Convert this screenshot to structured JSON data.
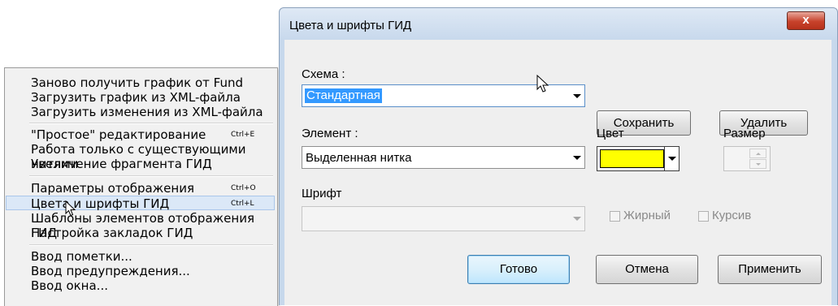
{
  "menu": {
    "items": [
      {
        "label": "Заново получить график от Fund",
        "shortcut": ""
      },
      {
        "label": "Загрузить график из XML-файла",
        "shortcut": ""
      },
      {
        "label": "Загрузить изменения из XML-файла",
        "shortcut": ""
      },
      {
        "label": "\"Простое\" редактирование",
        "shortcut": "Ctrl+E"
      },
      {
        "label": "Работа только с существующими нитями",
        "shortcut": ""
      },
      {
        "label": "Увеличение фрагмента ГИД",
        "shortcut": ""
      },
      {
        "label": "Параметры отображения",
        "shortcut": "Ctrl+O"
      },
      {
        "label": "Цвета и шрифты ГИД",
        "shortcut": "Ctrl+L"
      },
      {
        "label": "Шаблоны элементов отображения ГИД",
        "shortcut": ""
      },
      {
        "label": "Настройка закладок ГИД",
        "shortcut": ""
      },
      {
        "label": "Ввод пометки...",
        "shortcut": ""
      },
      {
        "label": "Ввод предупреждения...",
        "shortcut": ""
      },
      {
        "label": "Ввод окна...",
        "shortcut": ""
      }
    ],
    "highlighted_index": 7
  },
  "dialog": {
    "title": "Цвета и шрифты ГИД",
    "close_glyph": "x",
    "scheme_label": "Схема :",
    "scheme_value": "Стандартная",
    "save_label": "Сохранить",
    "delete_label": "Удалить",
    "element_label": "Элемент :",
    "element_value": "Выделенная нитка",
    "color_label": "Цвет",
    "color_value": "#ffff00",
    "size_label": "Размер",
    "font_label": "Шрифт",
    "font_value": "",
    "bold_label": "Жирный",
    "bold_checked": false,
    "italic_label": "Курсив",
    "italic_checked": false,
    "ok_label": "Готово",
    "cancel_label": "Отмена",
    "apply_label": "Применить"
  },
  "colors": {
    "selection": "#3399ff",
    "highlight": "#dbe8f7"
  }
}
